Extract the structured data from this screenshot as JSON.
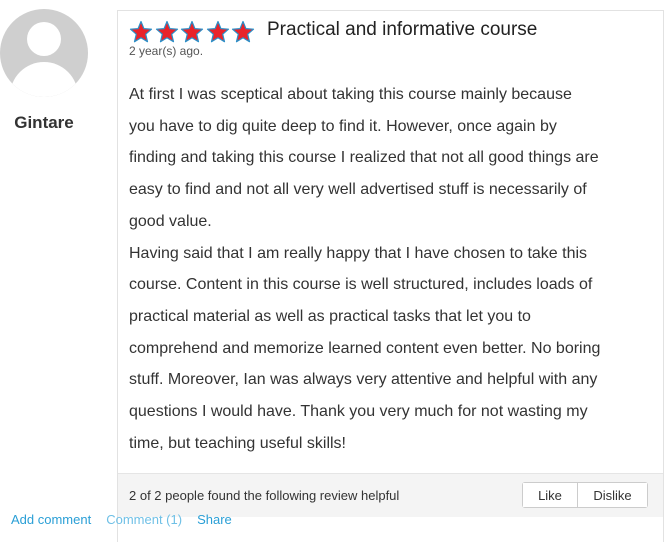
{
  "reviewer": {
    "name": "Gintare"
  },
  "review": {
    "rating": 5,
    "rating_max": 5,
    "star_color": "#e8232a",
    "star_outline": "#2a8fc8",
    "title": "Practical and informative course",
    "date": "2 year(s) ago.",
    "lines": [
      "At first I was sceptical about taking this course mainly because",
      "you have to dig quite deep to find it. However, once again by",
      "finding and taking this course I realized that not all good things are",
      "easy to find and not all very well advertised stuff is necessarily of",
      "good value.",
      "Having said that I am really happy that I have chosen to take this",
      "course. Content in this course is well structured, includes loads of",
      "practical material as well as practical tasks that let you to",
      "comprehend and memorize learned content even better. No boring",
      "stuff. Moreover, Ian was always very attentive and helpful with any",
      "questions I would have. Thank you very much for not wasting my",
      "time, but teaching useful skills!"
    ]
  },
  "helpful": {
    "text": "2 of 2 people found the following review helpful",
    "like_label": "Like",
    "dislike_label": "Dislike"
  },
  "actions": {
    "add_comment": "Add comment",
    "comment_count": "Comment (1)",
    "share": "Share"
  },
  "colors": {
    "link": "#2a9fd6",
    "avatar_bg": "#cfcfcf"
  }
}
